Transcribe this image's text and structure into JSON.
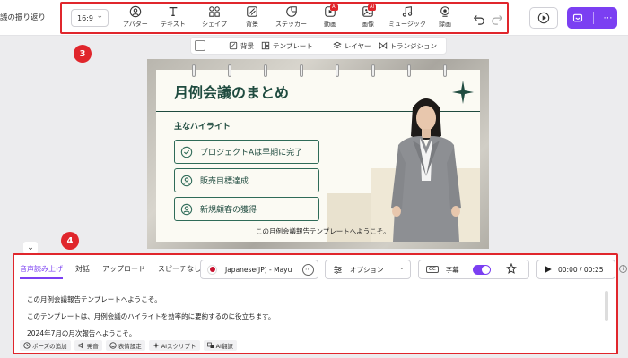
{
  "project": {
    "title": "議の振り返り"
  },
  "toolbar": {
    "ratio": "16:9",
    "tools": [
      {
        "label": "アバター",
        "icon": "avatar-icon"
      },
      {
        "label": "テキスト",
        "icon": "text-icon"
      },
      {
        "label": "シェイプ",
        "icon": "shape-icon"
      },
      {
        "label": "背景",
        "icon": "background-icon"
      },
      {
        "label": "ステッカー",
        "icon": "sticker-icon"
      },
      {
        "label": "動画",
        "icon": "video-icon",
        "badge": "AI"
      },
      {
        "label": "画像",
        "icon": "image-icon",
        "badge": "AI"
      },
      {
        "label": "ミュージック",
        "icon": "music-icon"
      },
      {
        "label": "録画",
        "icon": "record-icon"
      }
    ]
  },
  "canvas_toolbar": {
    "items": [
      {
        "label": "背景"
      },
      {
        "label": "テンプレート"
      },
      {
        "label": "レイヤー"
      },
      {
        "label": "トランジション"
      }
    ]
  },
  "steps": {
    "toolbar": "3",
    "panel": "4"
  },
  "slide": {
    "title": "月例会議のまとめ",
    "highlights_heading": "主なハイライト",
    "highlights": [
      {
        "label": "プロジェクトAは早期に完了"
      },
      {
        "label": "販売目標達成"
      },
      {
        "label": "新規顧客の獲得"
      }
    ],
    "caption": "この月例会議報告テンプレートへようこそ。"
  },
  "voice_panel": {
    "tabs": [
      "音声読み上げ",
      "対話",
      "アップロード",
      "スピーチなし"
    ],
    "voice": "Japanese(JP) - Mayu",
    "options_label": "オプション",
    "subtitle_label": "字幕",
    "subtitle_on": true,
    "time": "00:00 / 00:25",
    "script_lines": [
      "この月例会議報告テンプレートへようこそ。",
      "このテンプレートは、月例会議のハイライトを効率的に要約するのに役立ちます。",
      "2024年7月の月次報告へようこそ。"
    ],
    "actions": [
      {
        "label": "ポーズの追加",
        "icon": "pause-icon"
      },
      {
        "label": "発音",
        "icon": "pronunciation-icon"
      },
      {
        "label": "表情設定",
        "icon": "expression-icon"
      },
      {
        "label": "AIスクリプト",
        "icon": "ai-script-icon"
      },
      {
        "label": "AI翻訳",
        "icon": "translate-icon"
      }
    ]
  },
  "colors": {
    "accent": "#7b3ff2",
    "annotation": "#e0262c",
    "slide_green": "#1f4b3f"
  }
}
